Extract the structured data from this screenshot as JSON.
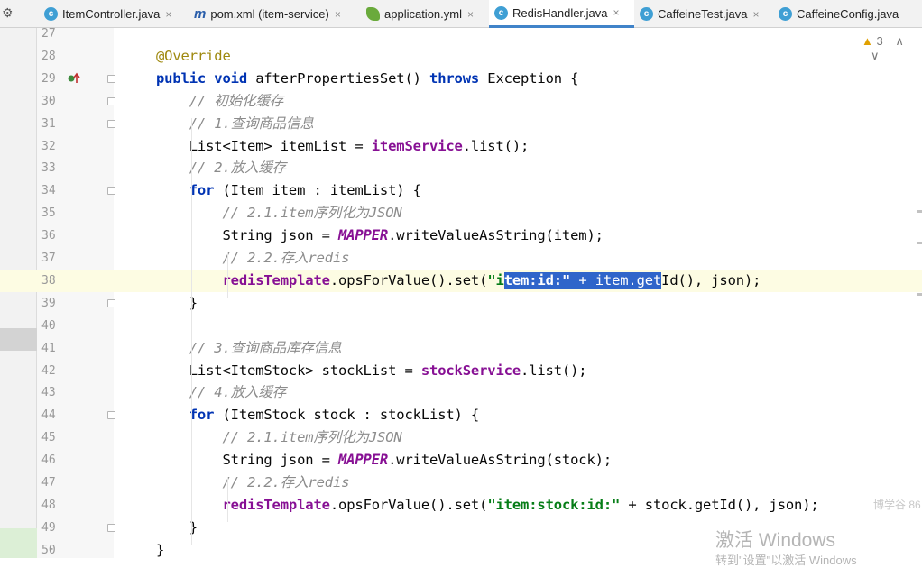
{
  "window_controls": {
    "settings": "⚙",
    "minimize": "—"
  },
  "tabs": [
    {
      "label": "ItemController.java",
      "icon": "c",
      "icon_name": "java-class-icon",
      "closable": true,
      "active": false
    },
    {
      "label": "pom.xml (item-service)",
      "icon": "m",
      "icon_name": "maven-icon",
      "closable": true,
      "active": false
    },
    {
      "label": "application.yml",
      "icon": "leaf",
      "icon_name": "spring-leaf-icon",
      "closable": true,
      "active": false
    },
    {
      "label": "RedisHandler.java",
      "icon": "c",
      "icon_name": "java-class-icon",
      "closable": true,
      "active": true
    },
    {
      "label": "CaffeineTest.java",
      "icon": "c",
      "icon_name": "java-class-icon",
      "closable": true,
      "active": false
    },
    {
      "label": "CaffeineConfig.java",
      "icon": "c",
      "icon_name": "java-class-icon",
      "closable": false,
      "active": false
    }
  ],
  "inspection": {
    "warning_count": "3"
  },
  "watermark": {
    "activate": "激活 Windows",
    "goto": "转到\"设置\"以激活 Windows",
    "small": "博学谷 86"
  },
  "lines": [
    {
      "n": "27",
      "fold": false,
      "segs": []
    },
    {
      "n": "28",
      "fold": false,
      "segs": [
        [
          "ann",
          "@Override"
        ]
      ]
    },
    {
      "n": "29",
      "fold": true,
      "segs": [
        [
          "kw",
          "public void "
        ],
        [
          "",
          "afterPropertiesSet() "
        ],
        [
          "kw",
          "throws "
        ],
        [
          "",
          "Exception {"
        ]
      ]
    },
    {
      "n": "30",
      "fold": true,
      "segs": [
        [
          "cm",
          "    // 初始化缓存"
        ]
      ]
    },
    {
      "n": "31",
      "fold": true,
      "segs": [
        [
          "cm",
          "    // 1.查询商品信息"
        ]
      ]
    },
    {
      "n": "32",
      "fold": false,
      "segs": [
        [
          "",
          "    List<Item> itemList = "
        ],
        [
          "fld",
          "itemService"
        ],
        [
          "",
          ".list();"
        ]
      ]
    },
    {
      "n": "33",
      "fold": false,
      "segs": [
        [
          "cm",
          "    // 2.放入缓存"
        ]
      ]
    },
    {
      "n": "34",
      "fold": true,
      "segs": [
        [
          "kw",
          "    for "
        ],
        [
          "",
          "(Item item : itemList) {"
        ]
      ]
    },
    {
      "n": "35",
      "fold": false,
      "segs": [
        [
          "cm",
          "        // 2.1.item序列化为JSON"
        ]
      ]
    },
    {
      "n": "36",
      "fold": false,
      "segs": [
        [
          "",
          "        String json = "
        ],
        [
          "cst",
          "MAPPER"
        ],
        [
          "",
          ".writeValueAsString(item);"
        ]
      ]
    },
    {
      "n": "37",
      "fold": false,
      "segs": [
        [
          "cm",
          "        // 2.2.存入redis"
        ]
      ]
    },
    {
      "n": "38",
      "fold": false,
      "cur": true,
      "segs": [
        [
          "",
          "        "
        ],
        [
          "fld",
          "redisTemplate"
        ],
        [
          "",
          ".opsForValue().set("
        ],
        [
          "str",
          "\"i"
        ],
        [
          "str sel",
          "tem:id:\""
        ],
        [
          "sel",
          " + item.get"
        ],
        [
          "",
          "Id(), json);"
        ]
      ]
    },
    {
      "n": "39",
      "fold": true,
      "segs": [
        [
          "",
          "    }"
        ]
      ]
    },
    {
      "n": "40",
      "fold": false,
      "segs": []
    },
    {
      "n": "41",
      "fold": false,
      "segs": [
        [
          "cm",
          "    // 3.查询商品库存信息"
        ]
      ]
    },
    {
      "n": "42",
      "fold": false,
      "segs": [
        [
          "",
          "    List<ItemStock> stockList = "
        ],
        [
          "fld",
          "stockService"
        ],
        [
          "",
          ".list();"
        ]
      ]
    },
    {
      "n": "43",
      "fold": false,
      "segs": [
        [
          "cm",
          "    // 4.放入缓存"
        ]
      ]
    },
    {
      "n": "44",
      "fold": true,
      "segs": [
        [
          "kw",
          "    for "
        ],
        [
          "",
          "(ItemStock stock : stockList) {"
        ]
      ]
    },
    {
      "n": "45",
      "fold": false,
      "segs": [
        [
          "cm",
          "        // 2.1.item序列化为JSON"
        ]
      ]
    },
    {
      "n": "46",
      "fold": false,
      "segs": [
        [
          "",
          "        String json = "
        ],
        [
          "cst",
          "MAPPER"
        ],
        [
          "",
          ".writeValueAsString(stock);"
        ]
      ]
    },
    {
      "n": "47",
      "fold": false,
      "segs": [
        [
          "cm",
          "        // 2.2.存入redis"
        ]
      ]
    },
    {
      "n": "48",
      "fold": false,
      "segs": [
        [
          "",
          "        "
        ],
        [
          "fld",
          "redisTemplate"
        ],
        [
          "",
          ".opsForValue().set("
        ],
        [
          "str",
          "\"item:stock:id:\""
        ],
        [
          "",
          " + stock.getId(), json);"
        ]
      ]
    },
    {
      "n": "49",
      "fold": true,
      "segs": [
        [
          "",
          "    }"
        ]
      ]
    },
    {
      "n": "50",
      "fold": false,
      "segs": [
        [
          "",
          "}"
        ]
      ]
    }
  ]
}
